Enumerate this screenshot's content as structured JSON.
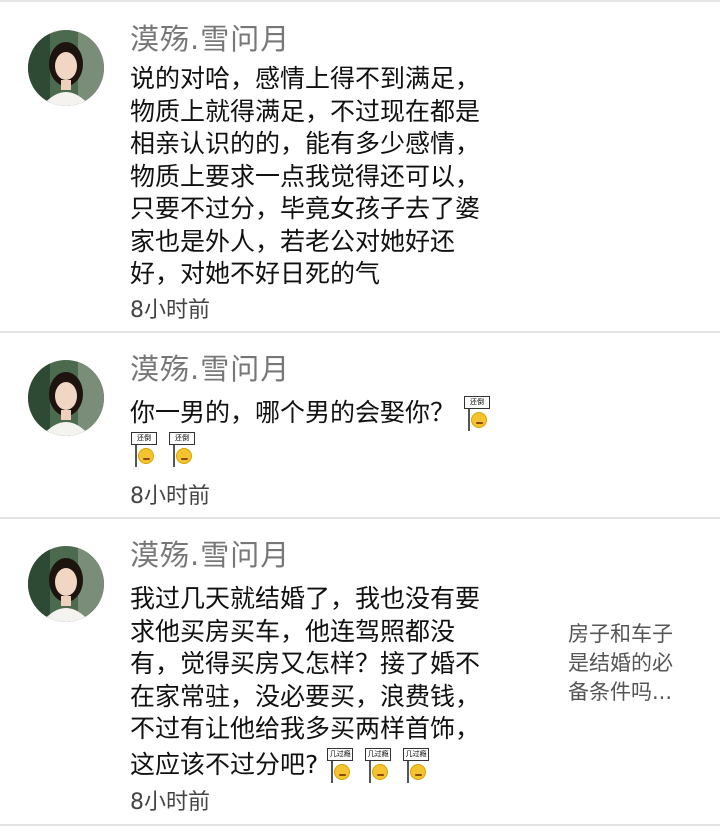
{
  "comments": [
    {
      "username": "漠殇.雪问月",
      "lines": [
        "说的对哈，感情上得不到满足，",
        "物质上就得满足，不过现在都是",
        "相亲认识的的，能有多少感情，",
        "物质上要求一点我觉得还可以，",
        "只要不过分，毕竟女孩子去了婆",
        "家也是外人，若老公对她好还",
        "好，对她不好日死的气"
      ],
      "time": "8小时前"
    },
    {
      "username": "漠殇.雪问月",
      "lines": [
        "你一男的，哪个男的会娶你？"
      ],
      "sticker_label": "还倒",
      "time": "8小时前"
    },
    {
      "username": "漠殇.雪问月",
      "lines": [
        "我过几天就结婚了，我也没有要",
        "求他买房买车，他连驾照都没",
        "有，觉得买房又怎样？接了婚不",
        "在家常驻，没必要买，浪费钱，",
        "不过有让他给我多买两样首饰，",
        "这应该不过分吧?"
      ],
      "sticker_label": "几过瘾",
      "time": "8小时前"
    }
  ],
  "side_note": {
    "lines": [
      "房子和车子",
      "是结婚的必",
      "备条件吗..."
    ]
  },
  "colors": {
    "username": "#777777",
    "divider": "#e3e3e3",
    "text": "#111111"
  },
  "icons": {
    "sticker": "sign-holding-emoji-icon",
    "avatar": "user-avatar-photo"
  }
}
